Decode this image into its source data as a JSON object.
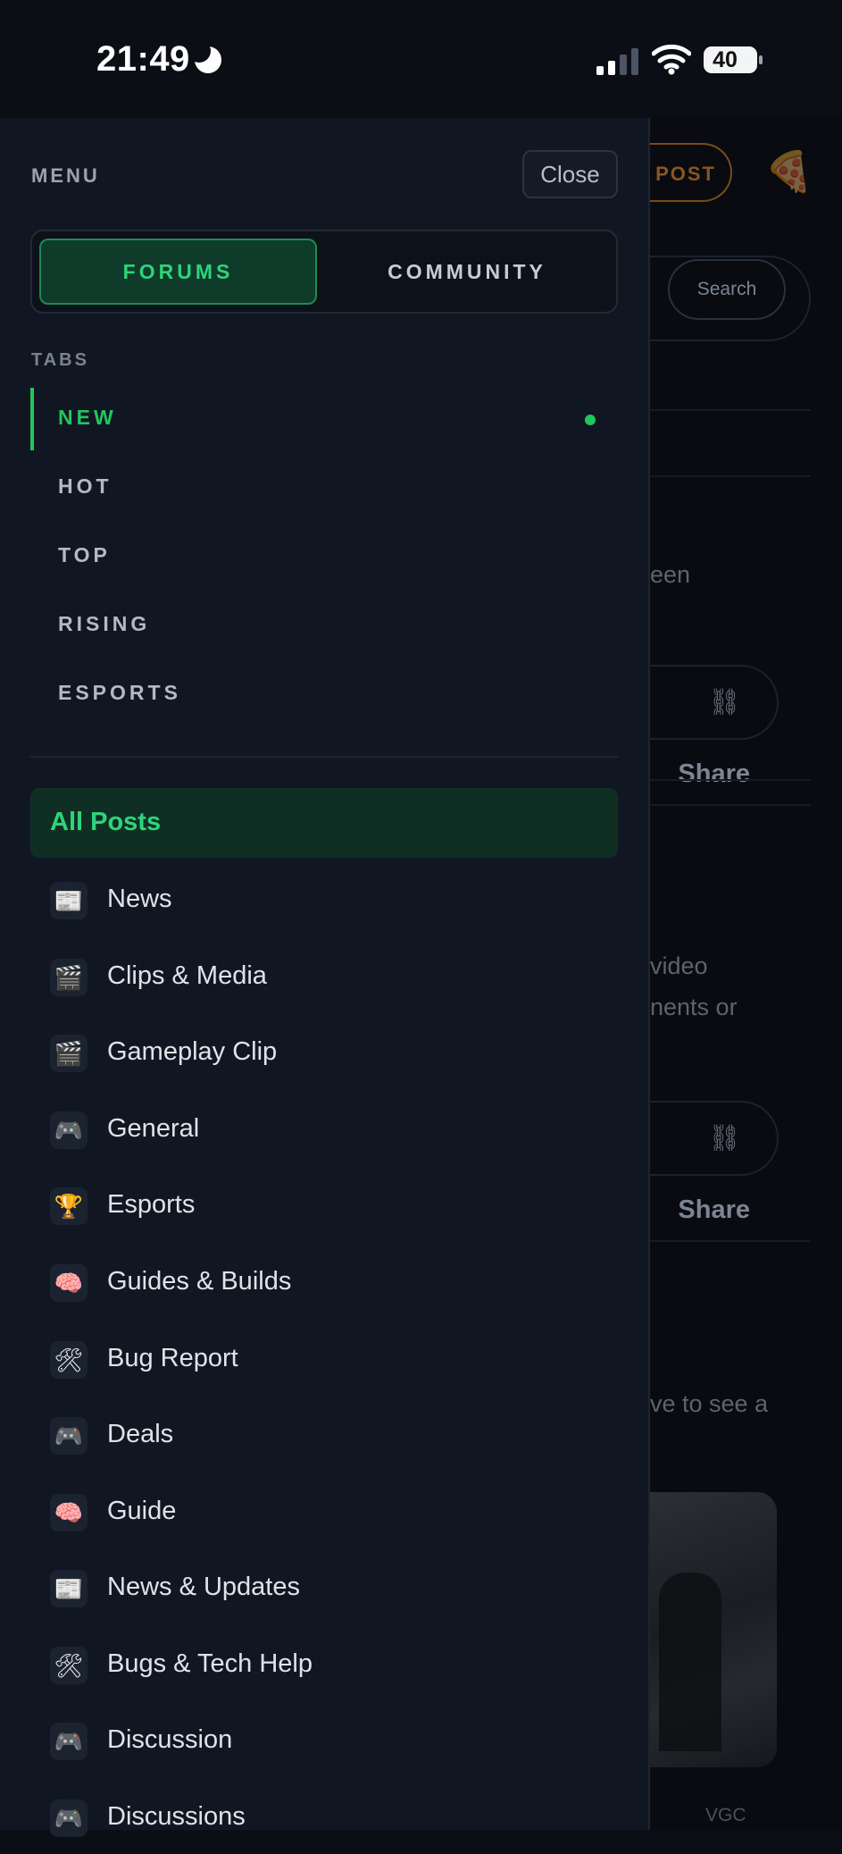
{
  "status_bar": {
    "time": "21:49",
    "battery": "40"
  },
  "background": {
    "post_button": "POST",
    "pizza_icon": "🍕",
    "search_button": "Search",
    "snippets": [
      "een",
      "video",
      "nents or",
      "ve to see a"
    ],
    "share_label": "Share",
    "tag": "VGC"
  },
  "drawer": {
    "menu_label": "MENU",
    "close_label": "Close",
    "segments": [
      "FORUMS",
      "COMMUNITY"
    ],
    "tabs_label": "TABS",
    "tabs": [
      "NEW",
      "HOT",
      "TOP",
      "RISING",
      "ESPORTS"
    ],
    "all_posts": "All Posts",
    "categories": [
      {
        "icon": "📰",
        "label": "News"
      },
      {
        "icon": "🎬",
        "label": "Clips & Media"
      },
      {
        "icon": "🎬",
        "label": "Gameplay Clip"
      },
      {
        "icon": "🎮",
        "label": "General"
      },
      {
        "icon": "🏆",
        "label": "Esports"
      },
      {
        "icon": "🧠",
        "label": "Guides & Builds"
      },
      {
        "icon": "🛠",
        "label": "Bug Report"
      },
      {
        "icon": "🎮",
        "label": "Deals"
      },
      {
        "icon": "🧠",
        "label": "Guide"
      },
      {
        "icon": "📰",
        "label": "News & Updates"
      },
      {
        "icon": "🛠",
        "label": "Bugs & Tech Help"
      },
      {
        "icon": "🎮",
        "label": "Discussion"
      },
      {
        "icon": "🎮",
        "label": "Discussions"
      }
    ]
  },
  "colors": {
    "accent": "#22c55e",
    "drawer_bg": "#111722",
    "post_accent": "#8a5522"
  }
}
